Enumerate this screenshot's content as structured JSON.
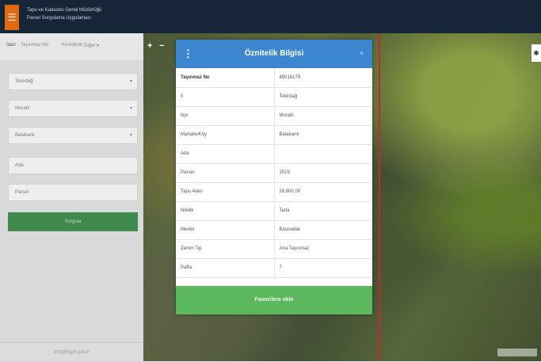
{
  "header": {
    "menu_icon": "☰",
    "title_line1": "Tapu ve Kadastro Genel Müdürlüğü",
    "title_line2": "Parsel Sorgulama Uygulaması"
  },
  "sidebar": {
    "tabs": [
      "İdari",
      "Taşınmaz No",
      "Koordinat",
      "Diğer ▾"
    ],
    "fields": [
      {
        "value": "Tekirdağ",
        "caret": "▾"
      },
      {
        "value": "Muratlı",
        "caret": "▾"
      },
      {
        "value": "Balabanlı",
        "caret": "▾"
      },
      {
        "value": "Ada",
        "caret": ""
      },
      {
        "value": "Parsel",
        "caret": ""
      }
    ],
    "query_button": "Sorgula",
    "footer_link": "info@tkgm.gov.tr"
  },
  "map": {
    "zoom_in": "+",
    "zoom_out": "−",
    "right_control": "✱"
  },
  "modal": {
    "menu_icon": "⋮",
    "title": "Öznitelik Bilgisi",
    "close_icon": "×",
    "rows": [
      {
        "key": "Taşınmaz No",
        "value": "45018179"
      },
      {
        "key": "İl",
        "value": "Tekirdağ"
      },
      {
        "key": "İlçe",
        "value": "Muratlı"
      },
      {
        "key": "Mahalle/Köy",
        "value": "Balabanlı"
      },
      {
        "key": "Ada",
        "value": ""
      },
      {
        "key": "Parsel",
        "value": "1519"
      },
      {
        "key": "Tapu Alanı",
        "value": "28.800,00"
      },
      {
        "key": "Nitelik",
        "value": "Tarla"
      },
      {
        "key": "Mevkii",
        "value": "Başıvatlar"
      },
      {
        "key": "Zemin Tip",
        "value": "Ana Taşınmaz"
      },
      {
        "key": "Pafta",
        "value": "7"
      }
    ],
    "favorite_button": "Favorilere ekle"
  }
}
